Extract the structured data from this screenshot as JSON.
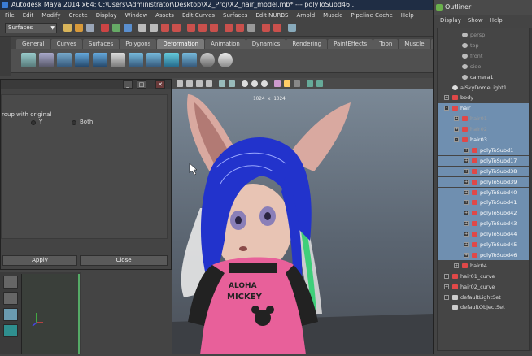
{
  "window_title": "Autodesk Maya 2014 x64: C:\\Users\\Administrator\\Desktop\\X2_Proj\\X2_hair_model.mb* --- polyToSubd46...",
  "menubar": [
    "File",
    "Edit",
    "Modify",
    "Create",
    "Display",
    "Window",
    "Assets",
    "Edit Curves",
    "Surfaces",
    "Edit NURBS",
    "Arnold",
    "Muscle",
    "Pipeline Cache",
    "Help"
  ],
  "mode_selector": "Surfaces",
  "shelf_tabs": [
    "General",
    "Curves",
    "Surfaces",
    "Polygons",
    "Deformation",
    "Animation",
    "Dynamics",
    "Rendering",
    "PaintEffects",
    "Toon",
    "Muscle",
    "Fluids",
    "Fur"
  ],
  "active_shelf_tab": "Deformation",
  "viewport": {
    "resolution_gate": "1024 x 1024",
    "shirt_text_line1": "ALOHA",
    "shirt_text_line2": "MICKEY"
  },
  "dialog": {
    "option_text": "roup with original",
    "radio_yes": "Y",
    "radio_both": "Both",
    "apply_label": "Apply",
    "close_label": "Close",
    "minimize_label": "_",
    "maximize_label": "□",
    "close_x": "✕"
  },
  "outliner": {
    "title": "Outliner",
    "menu": [
      "Display",
      "Show",
      "Help"
    ],
    "items": [
      {
        "label": "persp",
        "indent": 2,
        "dim": true,
        "sel": false,
        "exp": "",
        "icon": "camera-icon"
      },
      {
        "label": "top",
        "indent": 2,
        "dim": true,
        "sel": false,
        "exp": "",
        "icon": "camera-icon"
      },
      {
        "label": "front",
        "indent": 2,
        "dim": true,
        "sel": false,
        "exp": "",
        "icon": "camera-icon"
      },
      {
        "label": "side",
        "indent": 2,
        "dim": true,
        "sel": false,
        "exp": "",
        "icon": "camera-icon"
      },
      {
        "label": "camera1",
        "indent": 2,
        "dim": false,
        "sel": false,
        "exp": "",
        "icon": "camera-icon"
      },
      {
        "label": "aiSkyDomeLight1",
        "indent": 1,
        "dim": false,
        "sel": false,
        "exp": "",
        "icon": "light-icon"
      },
      {
        "label": "body",
        "indent": 1,
        "dim": false,
        "sel": false,
        "exp": "+",
        "icon": "transform-icon"
      },
      {
        "label": "hair",
        "indent": 1,
        "dim": false,
        "sel": true,
        "exp": "-",
        "icon": "transform-icon"
      },
      {
        "label": "hair01",
        "indent": 2,
        "dim": true,
        "sel": true,
        "exp": "+",
        "icon": "transform-icon"
      },
      {
        "label": "hair02",
        "indent": 2,
        "dim": true,
        "sel": true,
        "exp": "+",
        "icon": "transform-icon"
      },
      {
        "label": "hair03",
        "indent": 2,
        "dim": false,
        "sel": true,
        "exp": "-",
        "icon": "transform-icon"
      },
      {
        "label": "polyToSubd1",
        "indent": 3,
        "dim": false,
        "sel": true,
        "exp": "+",
        "icon": "mesh-icon"
      },
      {
        "label": "polyToSubd17",
        "indent": 3,
        "dim": false,
        "sel": true,
        "exp": "+",
        "icon": "mesh-icon"
      },
      {
        "label": "polyToSubd38",
        "indent": 3,
        "dim": false,
        "sel": true,
        "exp": "+",
        "icon": "mesh-icon"
      },
      {
        "label": "polyToSubd39",
        "indent": 3,
        "dim": false,
        "sel": true,
        "exp": "+",
        "icon": "mesh-icon"
      },
      {
        "label": "polyToSubd40",
        "indent": 3,
        "dim": false,
        "sel": true,
        "exp": "+",
        "icon": "mesh-icon"
      },
      {
        "label": "polyToSubd41",
        "indent": 3,
        "dim": false,
        "sel": true,
        "exp": "+",
        "icon": "mesh-icon"
      },
      {
        "label": "polyToSubd42",
        "indent": 3,
        "dim": false,
        "sel": true,
        "exp": "+",
        "icon": "mesh-icon"
      },
      {
        "label": "polyToSubd43",
        "indent": 3,
        "dim": false,
        "sel": true,
        "exp": "+",
        "icon": "mesh-icon"
      },
      {
        "label": "polyToSubd44",
        "indent": 3,
        "dim": false,
        "sel": true,
        "exp": "+",
        "icon": "mesh-icon"
      },
      {
        "label": "polyToSubd45",
        "indent": 3,
        "dim": false,
        "sel": true,
        "exp": "+",
        "icon": "mesh-icon"
      },
      {
        "label": "polyToSubd46",
        "indent": 3,
        "dim": false,
        "sel": true,
        "exp": "+",
        "icon": "mesh-icon"
      },
      {
        "label": "hair04",
        "indent": 2,
        "dim": false,
        "sel": false,
        "exp": "+",
        "icon": "transform-icon"
      },
      {
        "label": "hair01_curve",
        "indent": 1,
        "dim": false,
        "sel": false,
        "exp": "+",
        "icon": "curve-icon"
      },
      {
        "label": "hair02_curve",
        "indent": 1,
        "dim": false,
        "sel": false,
        "exp": "+",
        "icon": "curve-icon"
      },
      {
        "label": "defaultLightSet",
        "indent": 1,
        "dim": false,
        "sel": false,
        "exp": "+",
        "icon": "set-icon"
      },
      {
        "label": "defaultObjectSet",
        "indent": 1,
        "dim": false,
        "sel": false,
        "exp": "",
        "icon": "set-icon"
      }
    ]
  },
  "colors": {
    "title_bar": "#1f2d44",
    "selection": "#6f8fb0",
    "panel": "#444444",
    "hair_blue": "#2233cc",
    "ear_pink": "#d9a9a0"
  }
}
